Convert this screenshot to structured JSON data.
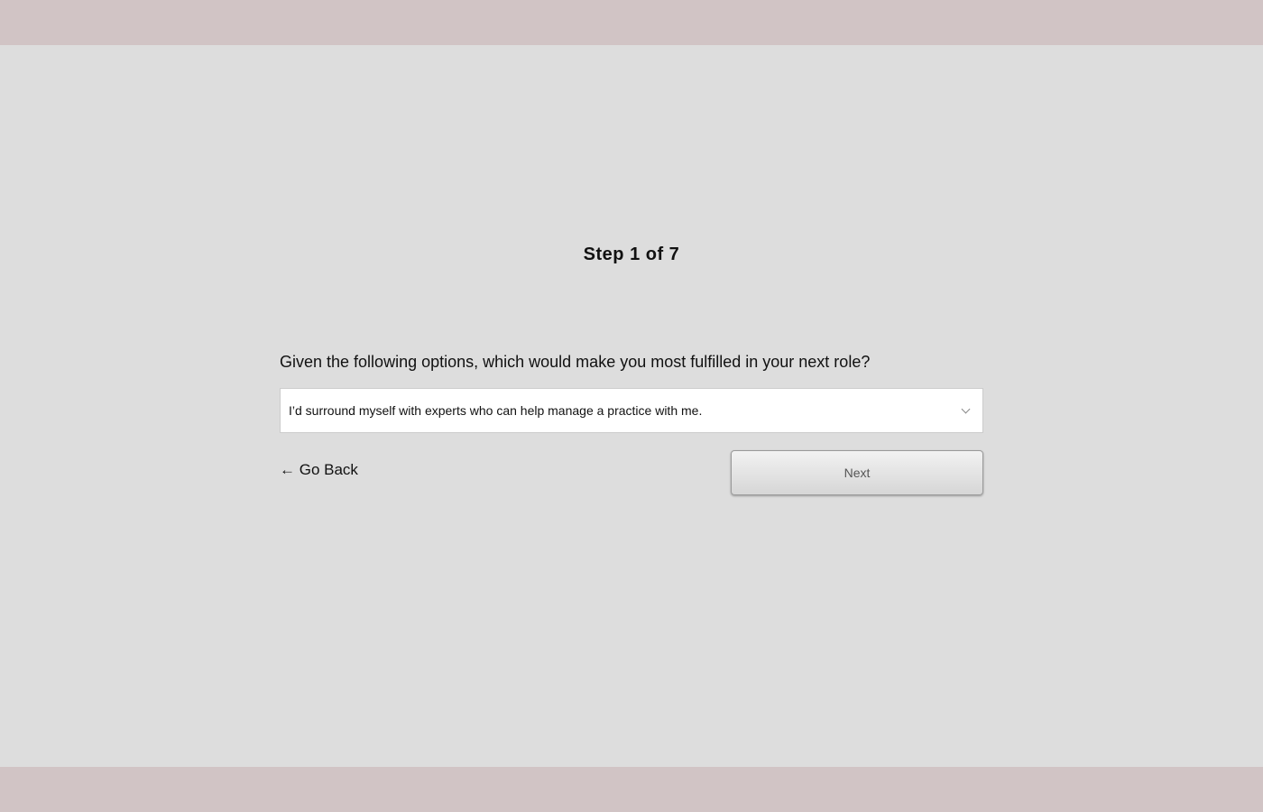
{
  "header": {
    "step_label": "Step 1 of 7"
  },
  "question": {
    "text": "Given the following options, which would make you most fulfilled in your next role?"
  },
  "select": {
    "value": "I’d surround myself with experts who can help manage a practice with me."
  },
  "actions": {
    "back_arrow": "←",
    "back_label": "Go Back",
    "next_label": "Next"
  }
}
